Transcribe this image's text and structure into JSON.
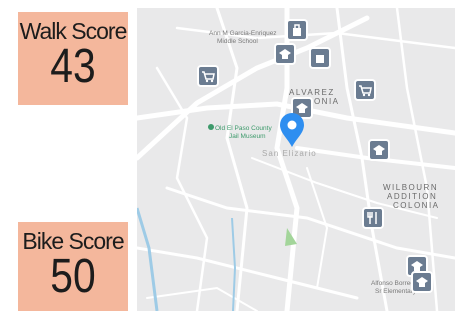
{
  "walk_score": {
    "label": "Walk Score",
    "value": "43"
  },
  "bike_score": {
    "label": "Bike Score",
    "value": "50"
  },
  "map": {
    "places": [
      {
        "name": "Ann M Garcia-Enriquez",
        "line2": "Middle School"
      },
      {
        "name": "Old El Paso County",
        "line2": "Jail Museum"
      }
    ],
    "areas": [
      {
        "line1": "ALVAREZ",
        "line2": "COLONIA"
      },
      {
        "line1": "WILBOURN",
        "line2": "ADDITION",
        "line3": "COLONIA"
      }
    ],
    "town": "San Elizario",
    "bottom_school": {
      "name": "Alfonso Borrego",
      "line2": "Sr Elementary"
    },
    "colors": {
      "pin": "#2e8ef0",
      "water": "#9ecbe6",
      "park": "#a3d59a",
      "marker": "#6b7c91"
    }
  }
}
